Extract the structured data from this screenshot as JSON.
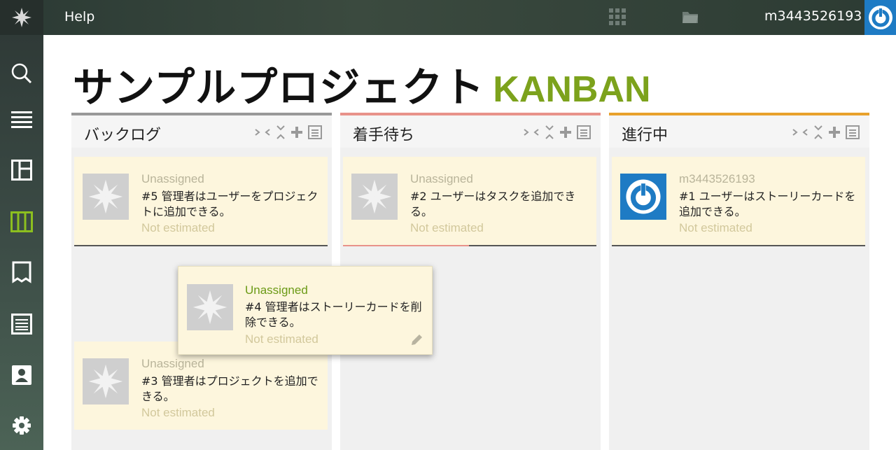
{
  "header": {
    "help_label": "Help",
    "username": "m3443526193"
  },
  "sidebar": {
    "items": [
      {
        "name": "search-icon"
      },
      {
        "name": "backlog-list-icon"
      },
      {
        "name": "dashboard-icon"
      },
      {
        "name": "kanban-icon",
        "active": true
      },
      {
        "name": "wiki-icon"
      },
      {
        "name": "issues-icon"
      },
      {
        "name": "team-icon"
      },
      {
        "name": "settings-icon"
      }
    ]
  },
  "page": {
    "title": "サンプルプロジェクト",
    "subtitle": "KANBAN"
  },
  "colors": {
    "accent_green": "#7ca21c",
    "backlog_border": "#999999",
    "ready_border": "#e8928a",
    "inprogress_border": "#e8a12c",
    "avatar_blue": "#1e7bc4"
  },
  "columns": [
    {
      "title": "バックログ",
      "cards": [
        {
          "assignee": "Unassigned",
          "text": "#5  管理者はユーザーをプロジェクトに追加できる。",
          "estimate": "Not estimated"
        },
        {
          "assignee": "Unassigned",
          "text": "#3  管理者はプロジェクトを追加できる。",
          "estimate": "Not estimated"
        }
      ]
    },
    {
      "title": "着手待ち",
      "cards": [
        {
          "assignee": "Unassigned",
          "text": "#2  ユーザーはタスクを追加できる。",
          "estimate": "Not estimated"
        }
      ]
    },
    {
      "title": "進行中",
      "cards": [
        {
          "assignee": "m3443526193",
          "text": "#1  ユーザーはストーリーカードを追加できる。",
          "estimate": "Not estimated"
        }
      ]
    }
  ],
  "dragging_card": {
    "assignee": "Unassigned",
    "text": "#4  管理者はストーリーカードを削除できる。",
    "estimate": "Not estimated"
  }
}
